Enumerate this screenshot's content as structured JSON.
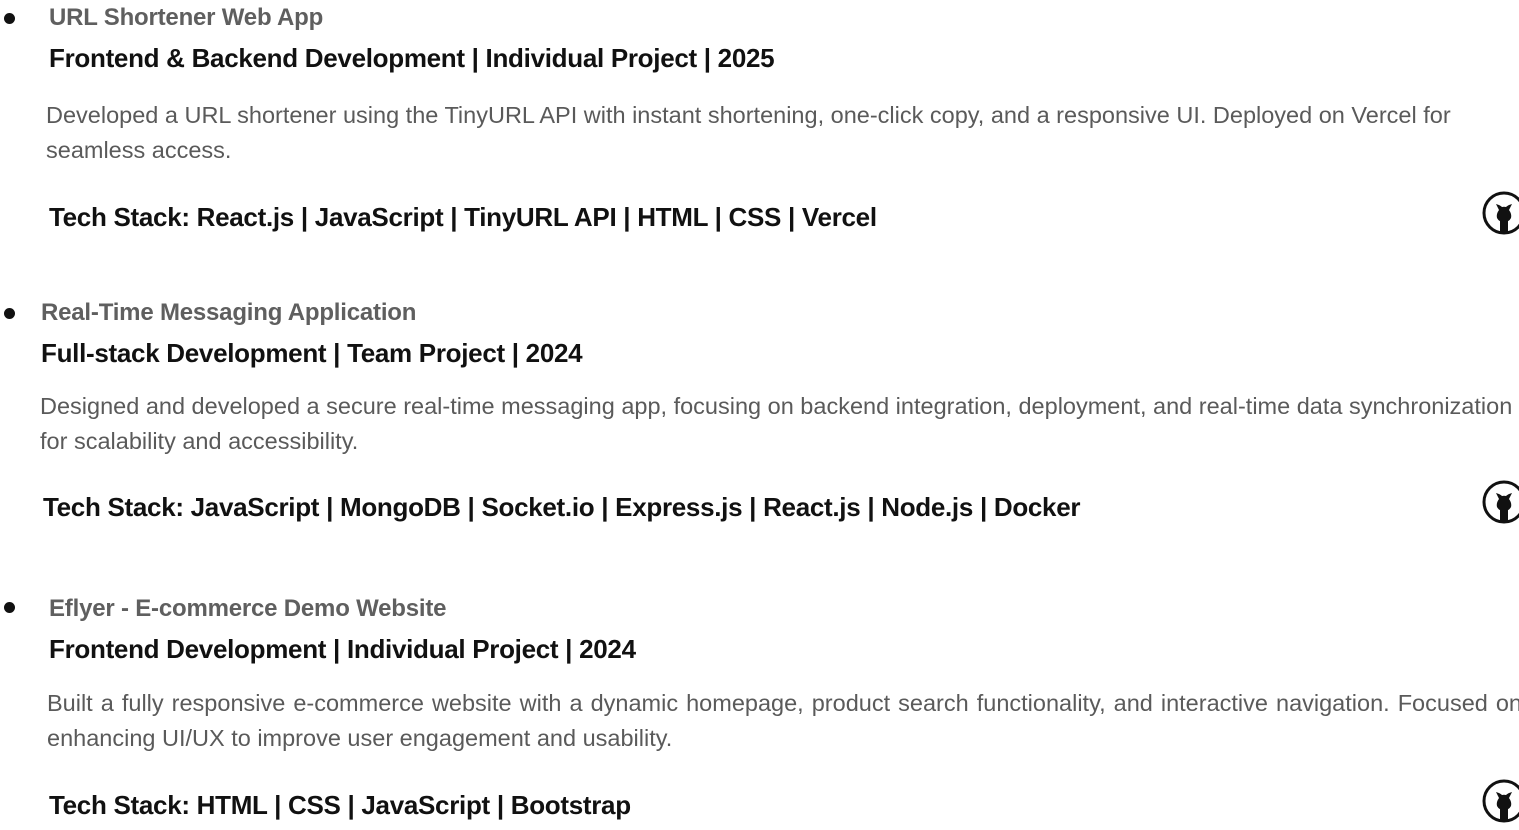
{
  "projects": [
    {
      "title": "URL Shortener Web App",
      "meta": "Frontend & Backend Development | Individual Project | 2025",
      "description": "Developed a URL shortener using the TinyURL API with instant shortening, one-click copy, and a responsive UI. Deployed on Vercel for seamless access.",
      "tech_stack": "Tech Stack: React.js | JavaScript | TinyURL API | HTML | CSS | Vercel",
      "link_icon": "github-icon"
    },
    {
      "title": "Real-Time Messaging Application",
      "meta": "Full-stack Development | Team Project | 2024",
      "description": "Designed and developed a secure real-time messaging app, focusing on backend integration, deployment, and real-time data synchronization for scalability and accessibility.",
      "tech_stack": "Tech Stack: JavaScript | MongoDB | Socket.io | Express.js | React.js | Node.js | Docker",
      "link_icon": "github-icon"
    },
    {
      "title": "Eflyer - E-commerce Demo Website",
      "meta": "Frontend Development | Individual Project | 2024",
      "description": "Built a fully responsive e-commerce website with a dynamic homepage, product search functionality, and interactive navigation. Focused on enhancing UI/UX to improve user engagement and usability.",
      "tech_stack": "Tech Stack: HTML | CSS | JavaScript | Bootstrap",
      "link_icon": "github-icon"
    }
  ],
  "colors": {
    "title": "#5f5f5f",
    "text": "#111111",
    "description": "#5a5a5a"
  }
}
